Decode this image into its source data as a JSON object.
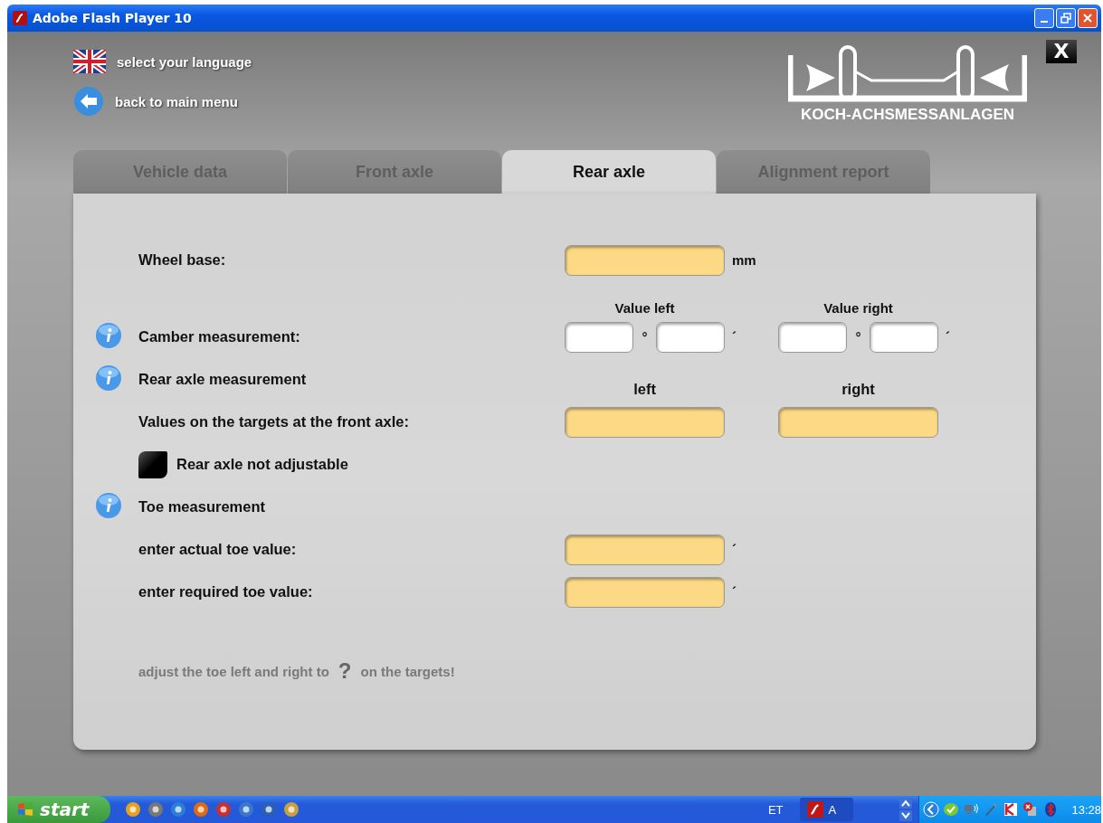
{
  "window": {
    "title": "Adobe Flash Player 10"
  },
  "header": {
    "language_link": "select your language",
    "back_link": "back to main menu",
    "logo_text": "KOCH-ACHSMESSANLAGEN",
    "close_label": "X"
  },
  "tabs": [
    {
      "label": "Vehicle data",
      "selected": false
    },
    {
      "label": "Front axle",
      "selected": false
    },
    {
      "label": "Rear axle",
      "selected": true
    },
    {
      "label": "Alignment report",
      "selected": false
    }
  ],
  "form": {
    "rows": [
      {
        "kind": "single",
        "label": "Wheel base:",
        "unit": "mm"
      },
      {
        "kind": "headings",
        "headings": [
          "Value left",
          "Value right"
        ]
      },
      {
        "kind": "camber",
        "info": true,
        "label": "Camber measurement:",
        "sides": [
          {
            "degree": "°",
            "minute": "´"
          },
          {
            "degree": "°",
            "minute": "´"
          }
        ]
      },
      {
        "kind": "section",
        "info": true,
        "label": "Rear axle measurement",
        "headings": [
          "left",
          "right"
        ]
      },
      {
        "kind": "pair",
        "label": "Values on the targets at the front axle:"
      },
      {
        "kind": "checkbox",
        "label": "Rear axle not adjustable",
        "checked": false
      },
      {
        "kind": "section",
        "info": true,
        "label": "Toe measurement"
      },
      {
        "kind": "single",
        "label": "enter actual toe value:",
        "unit": "´"
      },
      {
        "kind": "single",
        "label": "enter required toe value:",
        "unit": "´"
      },
      {
        "kind": "hint",
        "before": "adjust the toe left and right to",
        "symbol": "?",
        "after": "on the targets!"
      }
    ]
  },
  "taskbar": {
    "start": "start",
    "language": "ET",
    "task_label": "A",
    "clock": "13:28"
  }
}
